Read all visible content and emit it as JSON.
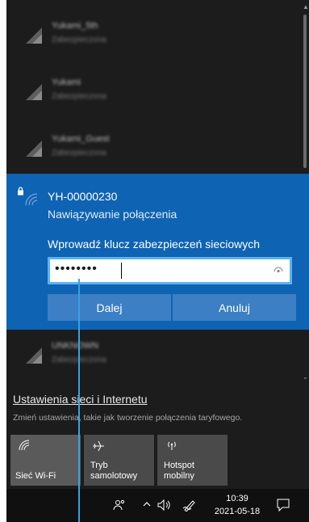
{
  "networks_above": [
    {
      "name": "Yukami_5th",
      "status": "Zabezpieczona"
    },
    {
      "name": "Yukami",
      "status": "Zabezpieczona"
    },
    {
      "name": "Yukami_Guest",
      "status": "Zabezpieczona"
    }
  ],
  "active_network": {
    "ssid": "YH-00000230",
    "status": "Nawiązywanie połączenia",
    "key_label": "Wprowadź klucz zabezpieczeń sieciowych",
    "key_value": "••••••••",
    "next_label": "Dalej",
    "cancel_label": "Anuluj"
  },
  "networks_below": [
    {
      "name": "UNKNOWN",
      "status": "Zabezpieczona"
    }
  ],
  "settings": {
    "link": "Ustawienia sieci i Internetu",
    "description": "Zmień ustawienia, takie jak tworzenie połączenia taryfowego."
  },
  "quick_actions": {
    "wifi": "Sieć Wi-Fi",
    "airplane_line1": "Tryb",
    "airplane_line2": "samolotowy",
    "hotspot_line1": "Hotspot",
    "hotspot_line2": "mobilny"
  },
  "taskbar": {
    "time": "10:39",
    "date": "2021-05-18"
  },
  "colors": {
    "accent": "#0f63b3",
    "flyout_bg": "#1c1c1c",
    "focus_border": "#5bb4f0"
  },
  "icons": [
    "wifi-icon",
    "lock-icon",
    "reveal-password-icon",
    "airplane-icon",
    "hotspot-icon",
    "people-icon",
    "chevron-up-icon",
    "volume-icon",
    "pen-icon",
    "notification-icon"
  ]
}
